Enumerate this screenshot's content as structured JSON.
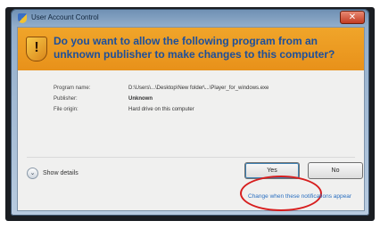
{
  "window": {
    "title": "User Account Control",
    "close_glyph": "✕"
  },
  "banner": {
    "question": "Do you want to allow the following program from an unknown publisher to make changes to this computer?",
    "shield_glyph": "!"
  },
  "details": {
    "program_name_label": "Program name:",
    "program_name_value": "D:\\Users\\...\\Desktop\\New folder\\...\\Player_for_windows.exe",
    "publisher_label": "Publisher:",
    "publisher_value": "Unknown",
    "file_origin_label": "File origin:",
    "file_origin_value": "Hard drive on this computer"
  },
  "footer": {
    "show_details_label": "Show details",
    "show_details_glyph": "⌄",
    "yes_label": "Yes",
    "no_label": "No",
    "change_settings_link": "Change when these notifications appear"
  },
  "colors": {
    "banner": "#e8911a",
    "banner_text": "#1c4f9c",
    "highlight_ring": "#d71e1e",
    "link": "#2a6fc0"
  }
}
